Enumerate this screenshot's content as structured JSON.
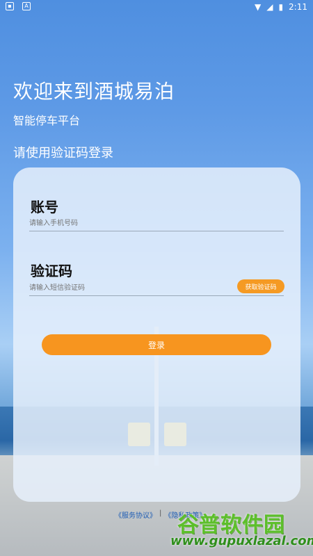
{
  "status_bar": {
    "time": "2:11",
    "icons": [
      "notification-icon",
      "app-a-icon",
      "wifi-icon",
      "sim-icon",
      "battery-icon"
    ]
  },
  "header": {
    "title": "欢迎来到酒城易泊",
    "subtitle": "智能停车平台",
    "hint": "请使用验证码登录"
  },
  "form": {
    "account_label": "账号",
    "account_placeholder": "请输入手机号码",
    "code_label": "验证码",
    "code_placeholder": "请输入短信验证码",
    "get_code_button": "获取验证码",
    "login_button": "登录"
  },
  "footer": {
    "service_agreement": "《服务协议》",
    "separator": "|",
    "privacy_policy": "《隐私政策》"
  },
  "watermark": {
    "brand": "谷普软件园",
    "url": "www.gupuxlazal.com"
  },
  "colors": {
    "accent": "#f7951f",
    "link": "#1e5db5"
  }
}
